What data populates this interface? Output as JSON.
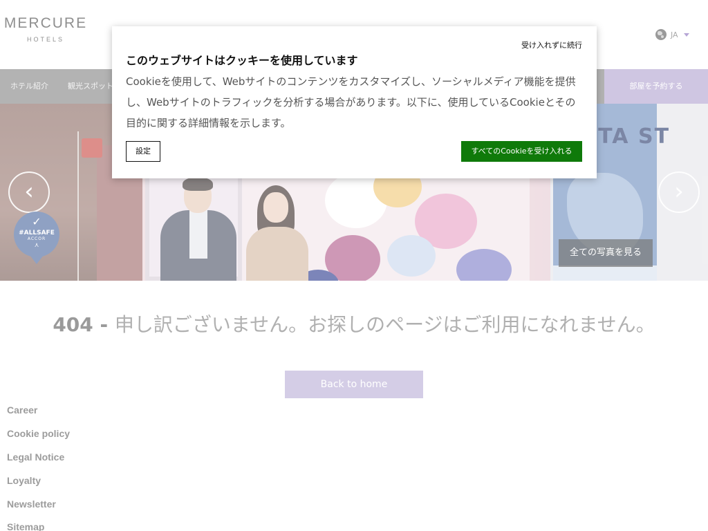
{
  "header": {
    "logo_main": "MERCURE",
    "logo_sub": "HOTELS",
    "language": "JA"
  },
  "nav": {
    "items": [
      "ホテル紹介",
      "観光スポット"
    ],
    "book_label": "部屋を予約する"
  },
  "hero": {
    "prev_label": "‹",
    "next_label": "›",
    "badge": {
      "check": "✓",
      "line1": "#ALLSAFE",
      "line2": "ACCOR",
      "line3": "⋏"
    },
    "photos_label": "全ての写真を見る",
    "poster_text": "ITA ST"
  },
  "error": {
    "code": "404 - ",
    "message": "申し訳ございません。お探しのページはご利用になれません。",
    "back_label": "Back to home"
  },
  "footer": {
    "links": [
      "Career",
      "Cookie policy",
      "Legal Notice",
      "Loyalty",
      "Newsletter",
      "Sitemap"
    ]
  },
  "cookie": {
    "reject_label": "受け入れずに続行",
    "title": "このウェブサイトはクッキーを使用しています",
    "description": "Cookieを使用して、Webサイトのコンテンツをカスタマイズし、ソーシャルメディア機能を提供し、Webサイトのトラフィックを分析する場合があります。以下に、使用しているCookieとその目的に関する詳細情報を示します。",
    "settings_label": "設定",
    "accept_label": "すべてのCookieを受け入れる"
  },
  "colors": {
    "brand_lavender": "#cfc6e2",
    "accept_green": "#0f7a0a",
    "nav_gray": "#b3b3b3"
  }
}
